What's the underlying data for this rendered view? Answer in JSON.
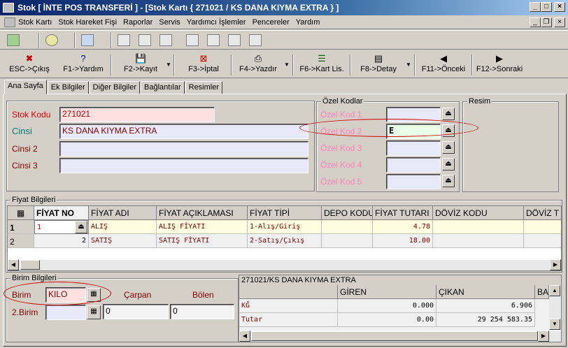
{
  "window": {
    "title": "Stok [ İNTE POS TRANSFERİ ] - [Stok Kartı { 271021 / KS DANA KIYMA EXTRA } ]"
  },
  "menu": [
    "Stok Kartı",
    "Stok Hareket Fişi",
    "Raporlar",
    "Servis",
    "Yardımcı İşlemler",
    "Pencereler",
    "Yardım"
  ],
  "toolbar2": [
    {
      "label": "ESC->Çıkış",
      "icon": "✖"
    },
    {
      "label": "F1->Yardım",
      "icon": "?"
    },
    {
      "label": "F2->Kayıt",
      "icon": "💾"
    },
    {
      "label": "F3->İptal",
      "icon": "⊠"
    },
    {
      "label": "F4->Yazdır",
      "icon": "⎙"
    },
    {
      "label": "F6->Kart Lis.",
      "icon": "☰"
    },
    {
      "label": "F8->Detay",
      "icon": "▤"
    },
    {
      "label": "F11->Önceki",
      "icon": "◀"
    },
    {
      "label": "F12->Sonraki",
      "icon": "▶"
    }
  ],
  "tabs": [
    "Ana Sayfa",
    "Ek Bilgiler",
    "Diğer Bilgiler",
    "Bağlantılar",
    "Resimler"
  ],
  "form": {
    "stok_kodu_label": "Stok Kodu",
    "stok_kodu": "271021",
    "cinsi_label": "Cinsi",
    "cinsi": "KS DANA KIYMA EXTRA",
    "cinsi2_label": "Cinsi 2",
    "cinsi2": "",
    "cinsi3_label": "Cinsi 3",
    "cinsi3": ""
  },
  "ozel": {
    "title": "Özel Kodlar",
    "labels": [
      "Özel Kod 1",
      "Özel Kod 2",
      "Özel Kod 3",
      "Özel Kod 4",
      "Özel Kod 5"
    ],
    "values": [
      "",
      "E",
      "",
      "",
      ""
    ]
  },
  "resim": {
    "title": "Resim"
  },
  "fiyat": {
    "title": "Fiyat Bilgileri",
    "columns": [
      "FİYAT NO",
      "FİYAT ADI",
      "FİYAT AÇIKLAMASI",
      "FİYAT TİPİ",
      "DEPO KODU",
      "FİYAT TUTARI",
      "DÖVİZ KODU",
      "DÖVİZ T"
    ],
    "rows": [
      {
        "n": "1",
        "no": "1",
        "adi": "ALIŞ",
        "aciklama": "ALIŞ FİYATI",
        "tipi": "1-Alış/Giriş",
        "depo": "",
        "tutar": "4.78",
        "doviz": ""
      },
      {
        "n": "2",
        "no": "2",
        "adi": "SATIŞ",
        "aciklama": "SATIŞ FİYATI",
        "tipi": "2-Satış/Çıkış",
        "depo": "",
        "tutar": "18.00",
        "doviz": ""
      }
    ]
  },
  "birim": {
    "title": "Birim Bilgileri",
    "birim_label": "Birim",
    "birim": "KILO",
    "birim2_label": "2.Birim",
    "birim2": "",
    "carpan_label": "Çarpan",
    "carpan": "0",
    "bolen_label": "Bölen",
    "bolen": "0"
  },
  "hareket": {
    "title": "271021/KS DANA KIYMA EXTRA",
    "columns": [
      "",
      "GİREN",
      "ÇIKAN",
      "BA"
    ],
    "rows": [
      {
        "label": "KĞ",
        "giren": "0.000",
        "cikan": "6.906"
      },
      {
        "label": "Tutar",
        "giren": "0.00",
        "cikan": "29 254 583.35"
      }
    ]
  }
}
